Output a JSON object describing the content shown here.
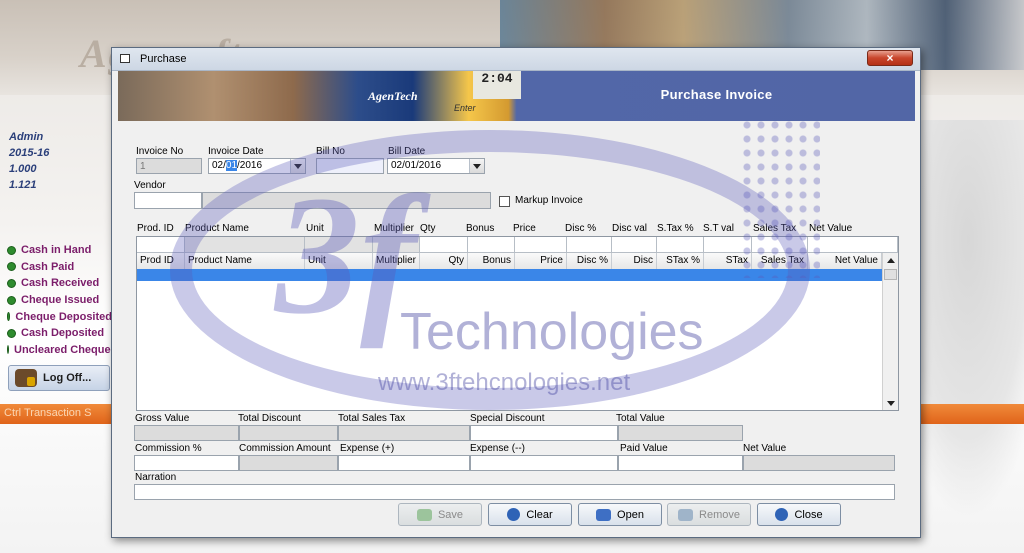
{
  "background": {
    "brand": "Agensoft",
    "info": [
      "Admin",
      "2015-16",
      "1.000",
      "1.121"
    ],
    "menu": [
      "Cash in Hand",
      "Cash Paid",
      "Cash Received",
      "Cheque Issued",
      "Cheque Deposited",
      "Cash Deposited",
      "Uncleared Cheques"
    ],
    "logoff_label": "Log Off...",
    "band_text": "Ctrl  Transaction  S"
  },
  "window": {
    "title": "Purchase",
    "close": "×",
    "banner_title": "Purchase Invoice",
    "banner_brand": "AgenTech",
    "banner_clock": "2:04",
    "banner_enter": "Enter"
  },
  "form": {
    "invoice_no_label": "Invoice No",
    "invoice_no": "1",
    "invoice_date_label": "Invoice Date",
    "invoice_date_pre": "02/",
    "invoice_date_hl": "01",
    "invoice_date_post": "/2016",
    "bill_no_label": "Bill No",
    "bill_no": "",
    "bill_date_label": "Bill Date",
    "bill_date": "02/01/2016",
    "vendor_label": "Vendor",
    "markup_label": "Markup Invoice"
  },
  "entry_headers": [
    "Prod. ID",
    "Product Name",
    "Unit",
    "Multiplier",
    "Qty",
    "Bonus",
    "Price",
    "Disc %",
    "Disc val",
    "S.Tax %",
    "S.T val",
    "Sales Tax",
    "Net Value"
  ],
  "grid_columns": [
    "Prod ID",
    "Product Name",
    "Unit",
    "Multiplier",
    "Qty",
    "Bonus",
    "Price",
    "Disc %",
    "Disc",
    "STax %",
    "STax",
    "Sales Tax",
    "Net Value"
  ],
  "totals": {
    "gross_value": "Gross Value",
    "total_discount": "Total Discount",
    "total_sales_tax": "Total Sales Tax",
    "special_discount": "Special Discount",
    "total_value": "Total Value",
    "commission_pct": "Commission %",
    "commission_amount": "Commission Amount",
    "expense_plus": "Expense (+)",
    "expense_minus": "Expense (--)",
    "paid_value": "Paid Value",
    "net_value": "Net Value",
    "narration": "Narration"
  },
  "buttons": {
    "save": "Save",
    "clear": "Clear",
    "open": "Open",
    "remove": "Remove",
    "close": "Close"
  },
  "watermark": {
    "logo": "3f",
    "text": "Technologies",
    "url": "www.3ftehcnologies.net"
  },
  "colors": {
    "banner": "#5266a6",
    "selection": "#3a86e8",
    "menu_text": "#7b1d6a",
    "band": "#e0641a"
  }
}
